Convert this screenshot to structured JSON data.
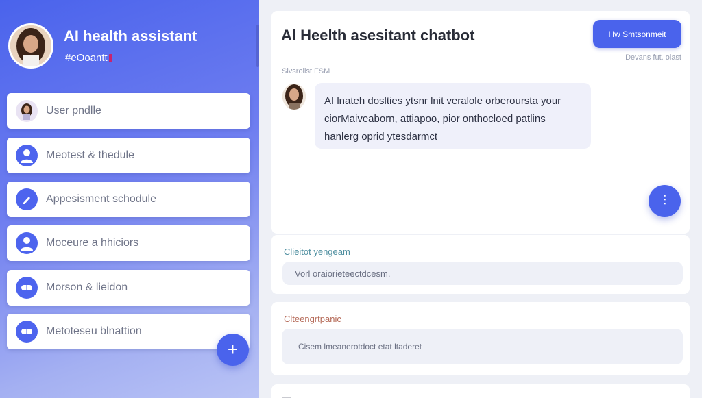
{
  "sidebar": {
    "title": "AI health assistant",
    "subtitle": "#eOoantt",
    "items": [
      {
        "label": "User pndlle",
        "icon": "user-photo-icon"
      },
      {
        "label": "Meotest & thedule",
        "icon": "person-icon"
      },
      {
        "label": "Appesisment schodule",
        "icon": "pen-icon"
      },
      {
        "label": "Moceure a hhiciors",
        "icon": "person-icon"
      },
      {
        "label": "Morson & lieidon",
        "icon": "pill-icon"
      },
      {
        "label": "Metoteseu blnattion",
        "icon": "pill-icon"
      }
    ],
    "fab_symbol": "+"
  },
  "chat": {
    "title": "Al Heelth asesitant chatbot",
    "new_chat_button": "Hw Smtsonmeit",
    "button_caption": "Devans fut. olast",
    "system_label": "Sivsrolist FSM",
    "message_lines": [
      "AI lnateh doslties ytsnr lnit veralole orberoursta your",
      "ciorMaiveaborn, attiapoo, pior onthocloed patlins",
      "hanlerg oprid ytesdarmct"
    ],
    "mic_symbol": "⫶"
  },
  "input_section": {
    "label": "Clieitot yengeam",
    "placeholder": "Vorl oraiorieteectdcesm."
  },
  "symptom_section": {
    "label": "Clteengrtpanic",
    "placeholder": "Cisem lmeanerotdoct etat ltaderet"
  },
  "bottom_section": {
    "label": "—"
  },
  "colors": {
    "accent": "#4a63ec",
    "bubble": "#eff0fa",
    "field": "#eef0f7",
    "background": "#eef0f6"
  }
}
